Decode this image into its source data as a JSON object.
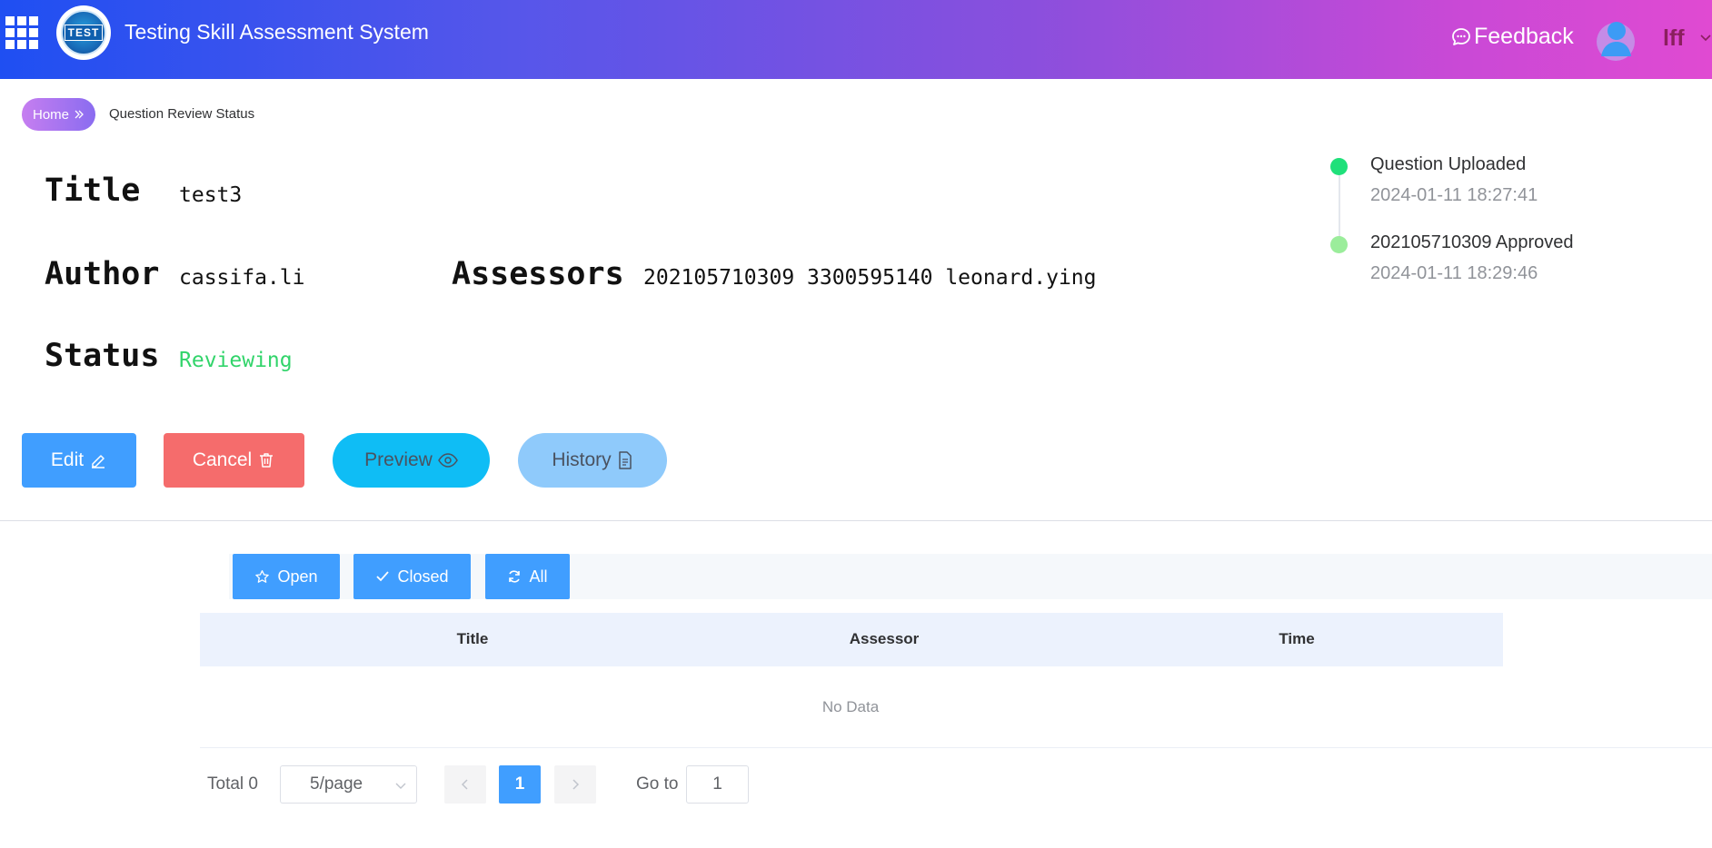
{
  "header": {
    "app_title": "Testing Skill Assessment System",
    "logo_text": "TEST",
    "feedback_label": "Feedback",
    "username": "lff",
    "gradient_start": "#1f4ff2",
    "gradient_end": "#e04ad2"
  },
  "breadcrumb": {
    "home": "Home",
    "current": "Question Review Status"
  },
  "question": {
    "title_label": "Title",
    "title_value": "test3",
    "author_label": "Author",
    "author_value": "cassifa.li",
    "assessors_label": "Assessors",
    "assessors_value": "202105710309 3300595140 leonard.ying",
    "status_label": "Status",
    "status_value": "Reviewing",
    "status_color": "#31d46a"
  },
  "timeline": [
    {
      "event": "Question Uploaded",
      "time": "2024-01-11 18:27:41",
      "dot_color": "#1fe07a"
    },
    {
      "event": "202105710309 Approved",
      "time": "2024-01-11 18:29:46",
      "dot_color": "#9bed9b"
    }
  ],
  "actions": {
    "edit": "Edit",
    "cancel": "Cancel",
    "preview": "Preview",
    "history": "History"
  },
  "filters": {
    "open": "Open",
    "closed": "Closed",
    "all": "All"
  },
  "table": {
    "columns": [
      "Title",
      "Assessor",
      "Time"
    ],
    "rows": [],
    "empty_text": "No Data"
  },
  "pagination": {
    "total": "Total 0",
    "page_size": "5/page",
    "current_page": "1",
    "goto_label": "Go to",
    "goto_value": "1"
  }
}
